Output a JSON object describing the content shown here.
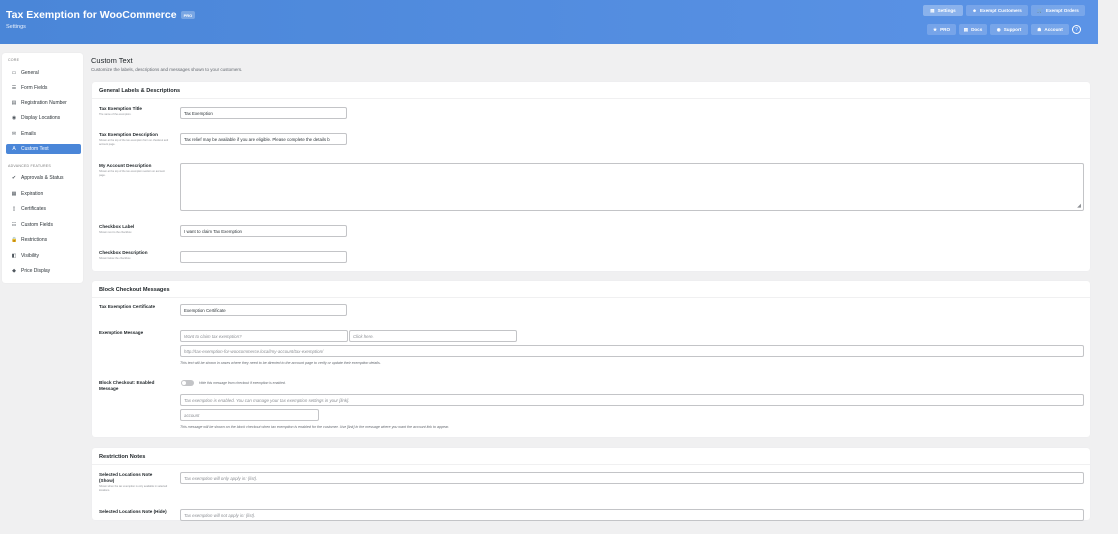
{
  "header": {
    "title": "Tax Exemption for WooCommerce",
    "badge": "PRO",
    "subtitle": "Settings",
    "nav": [
      {
        "label": "Settings",
        "icon": "settings-icon",
        "glyph": "▤"
      },
      {
        "label": "Exempt Customers",
        "icon": "users-icon",
        "glyph": "☻"
      },
      {
        "label": "Exempt Orders",
        "icon": "cart-icon",
        "glyph": "🛒"
      }
    ],
    "links": [
      {
        "label": "PRO",
        "icon": "star-icon",
        "glyph": "★"
      },
      {
        "label": "Docs",
        "icon": "docs-icon",
        "glyph": "▤"
      },
      {
        "label": "Support",
        "icon": "support-icon",
        "glyph": "◉"
      },
      {
        "label": "Account",
        "icon": "account-icon",
        "glyph": "☗"
      }
    ],
    "help_glyph": "?"
  },
  "sidebar": {
    "core_heading": "CORE",
    "advanced_heading": "ADVANCED FEATURES",
    "core_items": [
      {
        "label": "General",
        "glyph": "▭"
      },
      {
        "label": "Form Fields",
        "glyph": "☰"
      },
      {
        "label": "Registration Number",
        "glyph": "▤"
      },
      {
        "label": "Display Locations",
        "glyph": "◉"
      },
      {
        "label": "Emails",
        "glyph": "✉"
      },
      {
        "label": "Custom Text",
        "glyph": "A"
      }
    ],
    "advanced_items": [
      {
        "label": "Approvals & Status",
        "glyph": "✔"
      },
      {
        "label": "Expiration",
        "glyph": "▦"
      },
      {
        "label": "Certificates",
        "glyph": "▯"
      },
      {
        "label": "Custom Fields",
        "glyph": "☷"
      },
      {
        "label": "Restrictions",
        "glyph": "🔒"
      },
      {
        "label": "Visibility",
        "glyph": "◧"
      },
      {
        "label": "Price Display",
        "glyph": "◆"
      }
    ]
  },
  "main": {
    "title": "Custom Text",
    "subtitle": "Customize the labels, descriptions and messages shown to your customers."
  },
  "general": {
    "title": "General Labels & Descriptions",
    "title_label": "Tax Exemption Title",
    "title_help": "The name of the exemption.",
    "title_value": "Tax Exemption",
    "desc_label": "Tax Exemption Description",
    "desc_help": "Shown at the top of the tax exemption form on checkout and account page.",
    "desc_value": "Tax relief may be available if you are eligible. Please complete the details b",
    "account_label": "My Account Description",
    "account_help": "Shown at the top of the tax exemption section on account page.",
    "checkbox_label": "Checkbox Label",
    "checkbox_help": "Shown next to the checkbox.",
    "checkbox_value": "I want to claim Tax Exemption",
    "checkbox_desc_label": "Checkbox Description",
    "checkbox_desc_help": "Shown below the checkbox."
  },
  "block": {
    "title": "Block Checkout Messages",
    "cert_label": "Tax Exemption Certificate",
    "cert_value": "Exemption Certificate",
    "msg_label": "Exemption Message",
    "msg_ph1": "Want to claim tax exemption?",
    "msg_ph2": "Click here.",
    "msg_ph3": "http://tax-exemption-for-woocommerce.local/my-account/tax-exemption/",
    "msg_desc": "This text will be shown in cases where they need to be directed to the account page to verify or update their exemption details.",
    "enabled_label": "Block Checkout: Enabled Message",
    "enabled_toggle_text": "Hide this message from checkout if exemption is enabled.",
    "enabled_ph1": "Tax exemption is enabled. You can manage your tax exemption settings in your [link].",
    "enabled_ph2": "account",
    "enabled_desc": "This message will be shown on the block checkout when tax exemption is enabled for the customer. Use [link] in the message where you want the account link to appear."
  },
  "restriction": {
    "title": "Restriction Notes",
    "show_label": "Selected Locations Note (Show)",
    "show_help": "Shown when the tax exemption is only available in selected locations.",
    "show_ph": "Tax exemption will only apply in: {list}.",
    "hide_label": "Selected Locations Note (Hide)",
    "hide_ph": "Tax exemption will not apply in: {list}."
  }
}
